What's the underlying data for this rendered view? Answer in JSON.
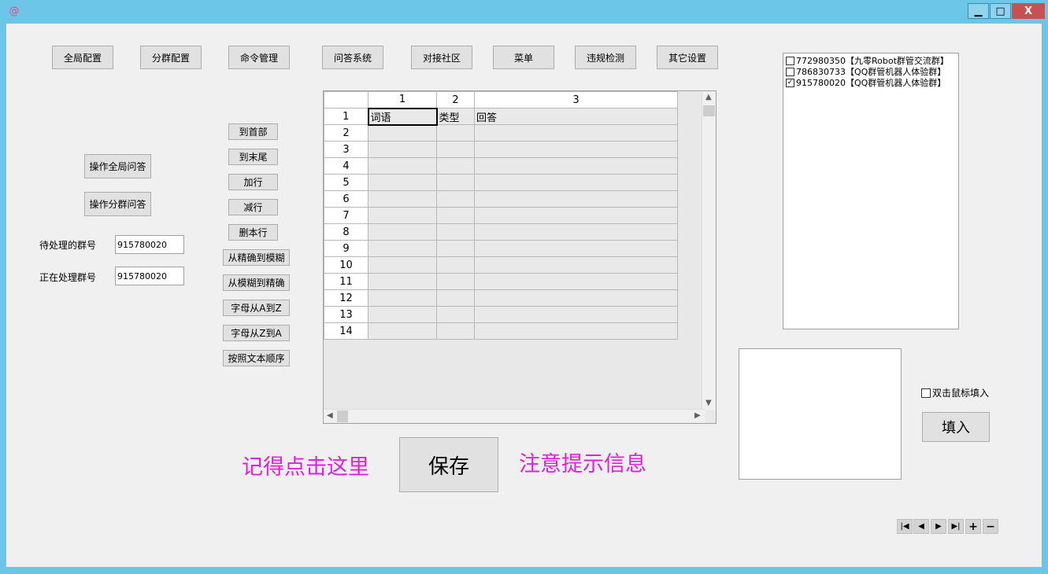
{
  "window": {
    "icon": "app-spiral-icon",
    "controls": {
      "minimize": "▁",
      "maximize": "□",
      "close": "X"
    }
  },
  "tabs": [
    "全局配置",
    "分群配置",
    "命令管理",
    "问答系统",
    "对接社区",
    "菜单",
    "违规检测",
    "其它设置"
  ],
  "left": {
    "op_global": "操作全局问答",
    "op_group": "操作分群问答",
    "pending_label": "待处理的群号",
    "pending_value": "915780020",
    "current_label": "正在处理群号",
    "current_value": "915780020"
  },
  "actions": [
    "到首部",
    "到末尾",
    "加行",
    "减行",
    "删本行",
    "从精确到模糊",
    "从模糊到精确",
    "字母从A到Z",
    "字母从Z到A",
    "按照文本顺序"
  ],
  "grid": {
    "columns": [
      "1",
      "2",
      "3"
    ],
    "rows": [
      {
        "num": "1",
        "cells": [
          "词语",
          "类型",
          "回答"
        ]
      },
      {
        "num": "2",
        "cells": [
          "",
          "",
          ""
        ]
      },
      {
        "num": "3",
        "cells": [
          "",
          "",
          ""
        ]
      },
      {
        "num": "4",
        "cells": [
          "",
          "",
          ""
        ]
      },
      {
        "num": "5",
        "cells": [
          "",
          "",
          ""
        ]
      },
      {
        "num": "6",
        "cells": [
          "",
          "",
          ""
        ]
      },
      {
        "num": "7",
        "cells": [
          "",
          "",
          ""
        ]
      },
      {
        "num": "8",
        "cells": [
          "",
          "",
          ""
        ]
      },
      {
        "num": "9",
        "cells": [
          "",
          "",
          ""
        ]
      },
      {
        "num": "10",
        "cells": [
          "",
          "",
          ""
        ]
      },
      {
        "num": "11",
        "cells": [
          "",
          "",
          ""
        ]
      },
      {
        "num": "12",
        "cells": [
          "",
          "",
          ""
        ]
      },
      {
        "num": "13",
        "cells": [
          "",
          "",
          ""
        ]
      },
      {
        "num": "14",
        "cells": [
          "",
          "",
          ""
        ]
      }
    ]
  },
  "save": {
    "hint_left": "记得点击这里",
    "button": "保存",
    "hint_right": "注意提示信息",
    "hint_color": "#e020e0"
  },
  "groups": [
    {
      "text": "772980350【九零Robot群管交流群】",
      "checked": false
    },
    {
      "text": "786830733【QQ群管机器人体验群】",
      "checked": false
    },
    {
      "text": "915780020【QQ群管机器人体验群】",
      "checked": true
    }
  ],
  "fill": {
    "dblclick_label": "双击鼠标填入",
    "dblclick_checked": false,
    "button": "填入"
  },
  "navigator": [
    "first-icon",
    "prev-icon",
    "next-icon",
    "last-icon",
    "add-icon",
    "remove-icon"
  ],
  "colors": {
    "title_bar": "#6cc6e8",
    "client": "#f0f0f0",
    "close": "#e81123"
  }
}
